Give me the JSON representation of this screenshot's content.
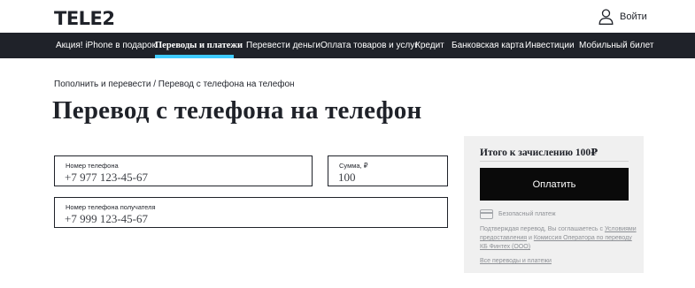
{
  "header": {
    "logo": "TELE2",
    "login_label": "Войти"
  },
  "nav": {
    "items": [
      {
        "label": "Акция! iPhone в подарок"
      },
      {
        "label": "Переводы и платежи",
        "active": true
      },
      {
        "label": "Перевести деньги"
      },
      {
        "label": "Оплата товаров и услуг"
      },
      {
        "label": "Кредит"
      },
      {
        "label": "Банковская карта"
      },
      {
        "label": "Инвестиции"
      },
      {
        "label": "Мобильный билет"
      }
    ]
  },
  "breadcrumb": {
    "parent": "Пополнить и перевести",
    "separator": " / ",
    "current": "Перевод с телефона на телефон"
  },
  "page_title": "Перевод с телефона на телефон",
  "form": {
    "phone": {
      "label": "Номер телефона",
      "value": "+7 977 123-45-67"
    },
    "amount": {
      "label": "Сумма, ₽",
      "value": "100"
    },
    "recipient": {
      "label": "Номер телефона получателя",
      "value": "+7 999 123-45-67"
    }
  },
  "summary": {
    "total_label": "Итого к зачислению 100₽",
    "pay_button": "Оплатить",
    "secure_label": "Безопасный платеж",
    "agreement_prefix": "Подтверждая перевод, Вы соглашаетесь с ",
    "terms_link": "Условиями предоставления",
    "agreement_and": " и ",
    "commission_link": "Комиссия Оператора по переводу КБ Финтех (ООО)",
    "all_transfers_link": "Все переводы и платежи"
  },
  "colors": {
    "nav_background": "#1f2229",
    "nav_active_underline": "#3fcbff",
    "pay_button": "#0a0a0a",
    "summary_background": "#f0f0f0"
  }
}
